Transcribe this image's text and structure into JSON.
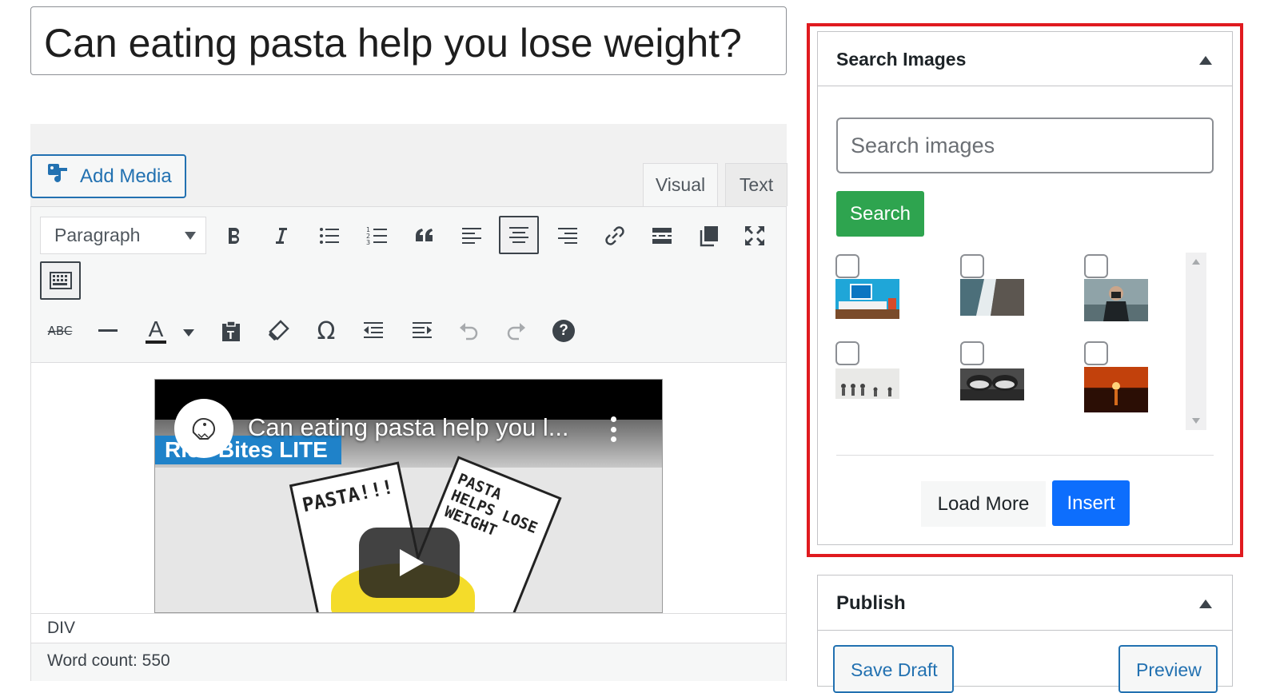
{
  "post": {
    "title": "Can eating pasta help you lose weight?"
  },
  "editor": {
    "add_media_label": "Add Media",
    "tabs": [
      {
        "label": "Visual",
        "active": true
      },
      {
        "label": "Text",
        "active": false
      }
    ],
    "format_select_value": "Paragraph",
    "toolbar_row1": [
      "bold-icon",
      "italic-icon",
      "bulleted-list-icon",
      "numbered-list-icon",
      "blockquote-icon",
      "align-left-icon",
      "align-center-icon",
      "align-right-icon",
      "link-icon",
      "read-more-icon",
      "copy-icon",
      "fullscreen-icon",
      "keyboard-icon"
    ],
    "toolbar_row2": [
      "strikethrough-icon",
      "horizontal-line-icon",
      "text-color-icon",
      "paste-text-icon",
      "clear-formatting-icon",
      "special-character-icon",
      "outdent-icon",
      "indent-icon",
      "undo-icon",
      "redo-icon",
      "help-icon"
    ],
    "text_color": "#000000",
    "strikethrough_glyph": "ABC",
    "text_color_glyph": "A",
    "omega_glyph": "Ω",
    "help_glyph": "?",
    "video": {
      "title": "Can eating pasta help you l...",
      "brand": "Rice Bites LITE",
      "paper1_text": "PASTA!!!",
      "paper2_text": "PASTA HELPS LOSE WEIGHT"
    },
    "status_path": "DIV",
    "word_count": "Word count: 550"
  },
  "search_images": {
    "title": "Search Images",
    "search_placeholder": "Search images",
    "search_button": "Search",
    "results": [
      {
        "name": "monitor-scene",
        "checked": false
      },
      {
        "name": "coast-cliff",
        "checked": false
      },
      {
        "name": "photographer-portrait",
        "checked": false
      },
      {
        "name": "people-row",
        "checked": false
      },
      {
        "name": "sneakers-edge",
        "checked": false
      },
      {
        "name": "sunset-sea",
        "checked": false
      }
    ],
    "load_more_label": "Load More",
    "insert_label": "Insert",
    "accent_search": "#2ea44f",
    "accent_insert": "#0d6efd",
    "highlight_color": "#e01a1f"
  },
  "publish": {
    "title": "Publish",
    "save_draft_label": "Save Draft",
    "preview_label": "Preview"
  }
}
